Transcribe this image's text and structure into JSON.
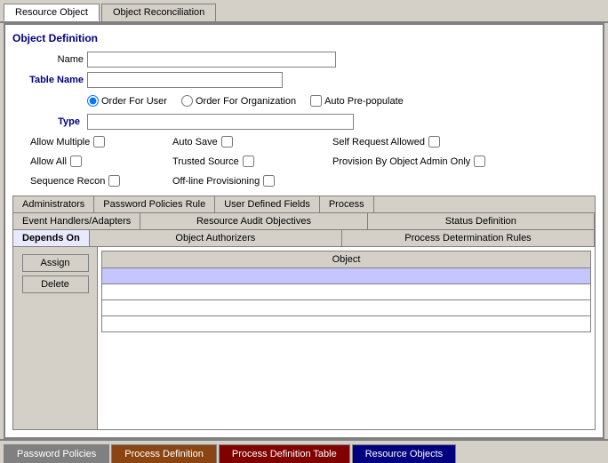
{
  "top_tabs": {
    "tab1": "Resource Object",
    "tab2": "Object Reconciliation",
    "active": "tab1"
  },
  "section": {
    "title": "Object Definition"
  },
  "form": {
    "name_label": "Name",
    "table_name_label": "Table Name",
    "name_value": "",
    "table_name_value": "",
    "radio_options": [
      {
        "id": "order_user",
        "label": "Order For User",
        "checked": true
      },
      {
        "id": "order_org",
        "label": "Order For Organization",
        "checked": false
      },
      {
        "id": "auto_pre",
        "label": "Auto Pre-populate",
        "checked": false
      }
    ],
    "type_label": "Type",
    "type_value": "",
    "checkboxes_row1": [
      {
        "label": "Allow Multiple",
        "checked": false
      },
      {
        "label": "Auto Save",
        "checked": false
      },
      {
        "label": "Self Request Allowed",
        "checked": false
      }
    ],
    "checkboxes_row2": [
      {
        "label": "Allow All",
        "checked": false
      },
      {
        "label": "Trusted Source",
        "checked": false
      },
      {
        "label": "Provision By Object Admin Only",
        "checked": false
      }
    ],
    "checkboxes_row3": [
      {
        "label": "Sequence Recon",
        "checked": false
      },
      {
        "label": "Off-line Provisioning",
        "checked": false
      }
    ]
  },
  "inner_tabs_row1": [
    {
      "label": "Administrators",
      "active": false
    },
    {
      "label": "Password Policies Rule",
      "active": false
    },
    {
      "label": "User Defined Fields",
      "active": false
    },
    {
      "label": "Process",
      "active": false
    }
  ],
  "inner_tabs_row2": [
    {
      "label": "Event Handlers/Adapters",
      "active": false
    },
    {
      "label": "Resource Audit Objectives",
      "active": false
    },
    {
      "label": "Status Definition",
      "active": false
    }
  ],
  "inner_tabs_row3": [
    {
      "label": "Depends On",
      "active": true
    },
    {
      "label": "Object Authorizers",
      "active": false
    },
    {
      "label": "Process Determination Rules",
      "active": false
    }
  ],
  "left_buttons": [
    {
      "label": "Assign",
      "name": "assign-button"
    },
    {
      "label": "Delete",
      "name": "delete-button"
    }
  ],
  "table": {
    "headers": [
      "Object"
    ],
    "rows": [
      {
        "cells": [
          ""
        ]
      }
    ]
  },
  "bottom_tabs": [
    {
      "label": "Password Policies",
      "style": "gray"
    },
    {
      "label": "Process Definition",
      "style": "brown"
    },
    {
      "label": "Process Definition Table",
      "style": "dark-red"
    },
    {
      "label": "Resource Objects",
      "style": "dark-blue"
    }
  ]
}
